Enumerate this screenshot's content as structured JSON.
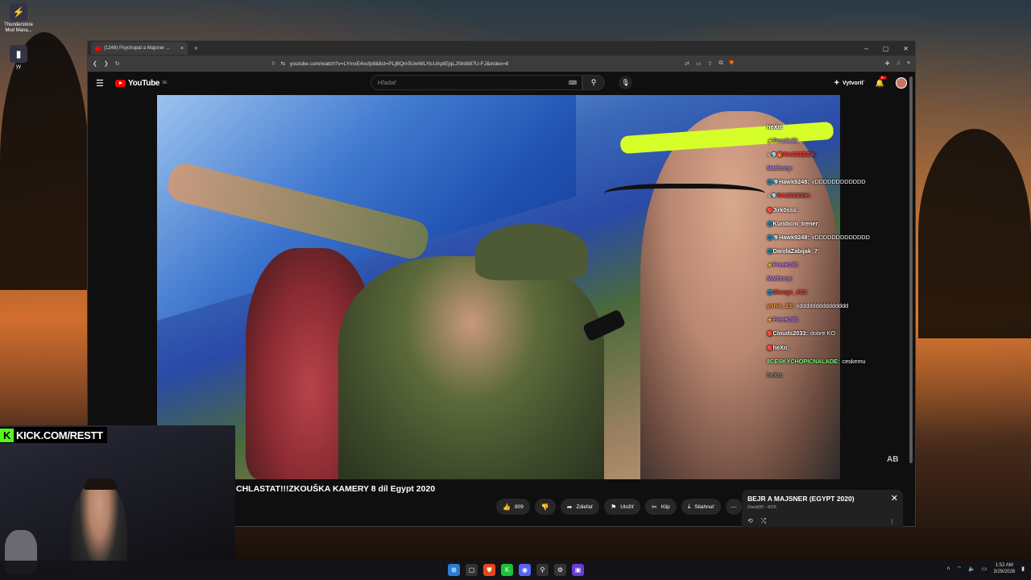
{
  "desktop": {
    "icons": [
      {
        "label": "Thunderstore Mod Mana..."
      },
      {
        "label": "yy"
      }
    ]
  },
  "browser": {
    "tab_title": "(1248) Psychopat a Majsner ...",
    "new_tab": "+",
    "url": "youtube.com/watch?v=LYmxE4xcfp8&list=PLjBQm5UwWLYicUAptEjqLJSln8i87U-FJ&index=8",
    "window_controls": [
      "–",
      "▢",
      "✕"
    ]
  },
  "youtube": {
    "logo": "YouTube",
    "logo_region": "SK",
    "search_placeholder": "Hľadať",
    "create_label": "Vytvoriť",
    "notification_count": "9+",
    "video_title": "CHLASTAT!!!ZKOUŠKA KAMERY 8 díl Egypt 2020",
    "actions": {
      "likes": "809",
      "share": "Zdieľať",
      "save": "Uložiť",
      "clip": "Klip",
      "download": "Stiahnuť"
    },
    "playlist": {
      "title": "BEJR A MAJSNER (EGYPT 2020)",
      "subtitle": "David35 - 8/26"
    },
    "watermark": "AB"
  },
  "chat": [
    {
      "user": "heXn:",
      "msg": "",
      "color": "#ffffff",
      "badges": ""
    },
    {
      "user": "FreeKrill:",
      "msg": "",
      "color": "#b77cff",
      "badges": "⚡"
    },
    {
      "user": "RAZEEEEK:",
      "msg": "",
      "color": "#ff3b3b",
      "badges": "⚔💎🎁"
    },
    {
      "user": "Mathony:",
      "msg": "",
      "color": "#b77cff",
      "badges": ""
    },
    {
      "user": "Hawk9248:",
      "msg": "xDDDDDDDDDDDD",
      "color": "#ffffff",
      "badges": "🌐💎"
    },
    {
      "user": "RAZEEEEK:",
      "msg": "",
      "color": "#ff3b3b",
      "badges": "⚔💎"
    },
    {
      "user": "Jirk0sss:",
      "msg": "",
      "color": "#ffffff",
      "badges": "🔴"
    },
    {
      "user": "Kundicni_trener:",
      "msg": "",
      "color": "#ffffff",
      "badges": "🌐"
    },
    {
      "user": "Hawk9248:",
      "msg": "xDDDDDDDDDDDDD",
      "color": "#ffffff",
      "badges": "🌐💎"
    },
    {
      "user": "DandaZabijak_7:",
      "msg": "",
      "color": "#ffffff",
      "badges": "🌐"
    },
    {
      "user": "FreeKrill:",
      "msg": "",
      "color": "#b77cff",
      "badges": "⚡"
    },
    {
      "user": "Mathony:",
      "msg": "",
      "color": "#b77cff",
      "badges": ""
    },
    {
      "user": "Skroge_492:",
      "msg": "",
      "color": "#ff3b3b",
      "badges": "🌐"
    },
    {
      "user": "yonie_23:",
      "msg": "xddddddddddddddd",
      "color": "#ff9a3b",
      "badges": ""
    },
    {
      "user": "FreeKrill:",
      "msg": "",
      "color": "#b77cff",
      "badges": "⚡"
    },
    {
      "user": "Clouds2033:",
      "msg": "dobre KO",
      "color": "#ffffff",
      "badges": "🔴"
    },
    {
      "user": "heXn:",
      "msg": "",
      "color": "#ffffff",
      "badges": "🔴"
    },
    {
      "user": "8CESKYCHOPICNALADE:",
      "msg": "ceskemu",
      "color": "#7cff7c",
      "badges": ""
    },
    {
      "user": "heXn:",
      "msg": "",
      "color": "#888888",
      "badges": ""
    }
  ],
  "stream": {
    "kick_label": "KICK.COM/RESTT"
  },
  "taskbar": {
    "time": "1:52 AM",
    "date": "3/29/2026"
  }
}
